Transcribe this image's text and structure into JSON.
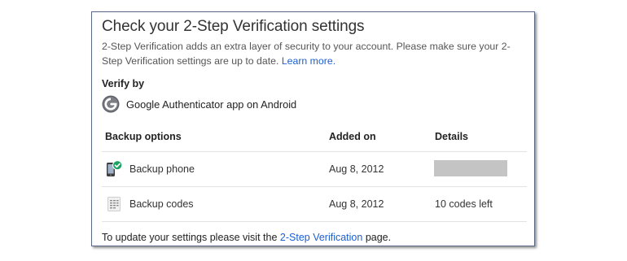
{
  "title": "Check your 2-Step Verification settings",
  "intro": {
    "text": "2-Step Verification adds an extra layer of security to your account. Please make sure your 2-Step Verification settings are up to date.",
    "link": "Learn more."
  },
  "verify": {
    "label": "Verify by",
    "method": "Google Authenticator app on Android",
    "icon": "google-authenticator-icon"
  },
  "table": {
    "headers": [
      "Backup options",
      "Added on",
      "Details"
    ],
    "rows": [
      {
        "name": "Backup phone",
        "added": "Aug 8, 2012",
        "details": "",
        "details_redacted": true,
        "icon": "phone-check-icon"
      },
      {
        "name": "Backup codes",
        "added": "Aug 8, 2012",
        "details": "10 codes left",
        "details_redacted": false,
        "icon": "codes-icon"
      }
    ]
  },
  "footer": {
    "before": "To update your settings please visit the",
    "link": "2-Step Verification",
    "after": "page."
  },
  "colors": {
    "link": "#1a5fd6",
    "check_badge": "#1aa260",
    "card_border": "#5a6a86",
    "redaction": "#c4c4c4"
  }
}
